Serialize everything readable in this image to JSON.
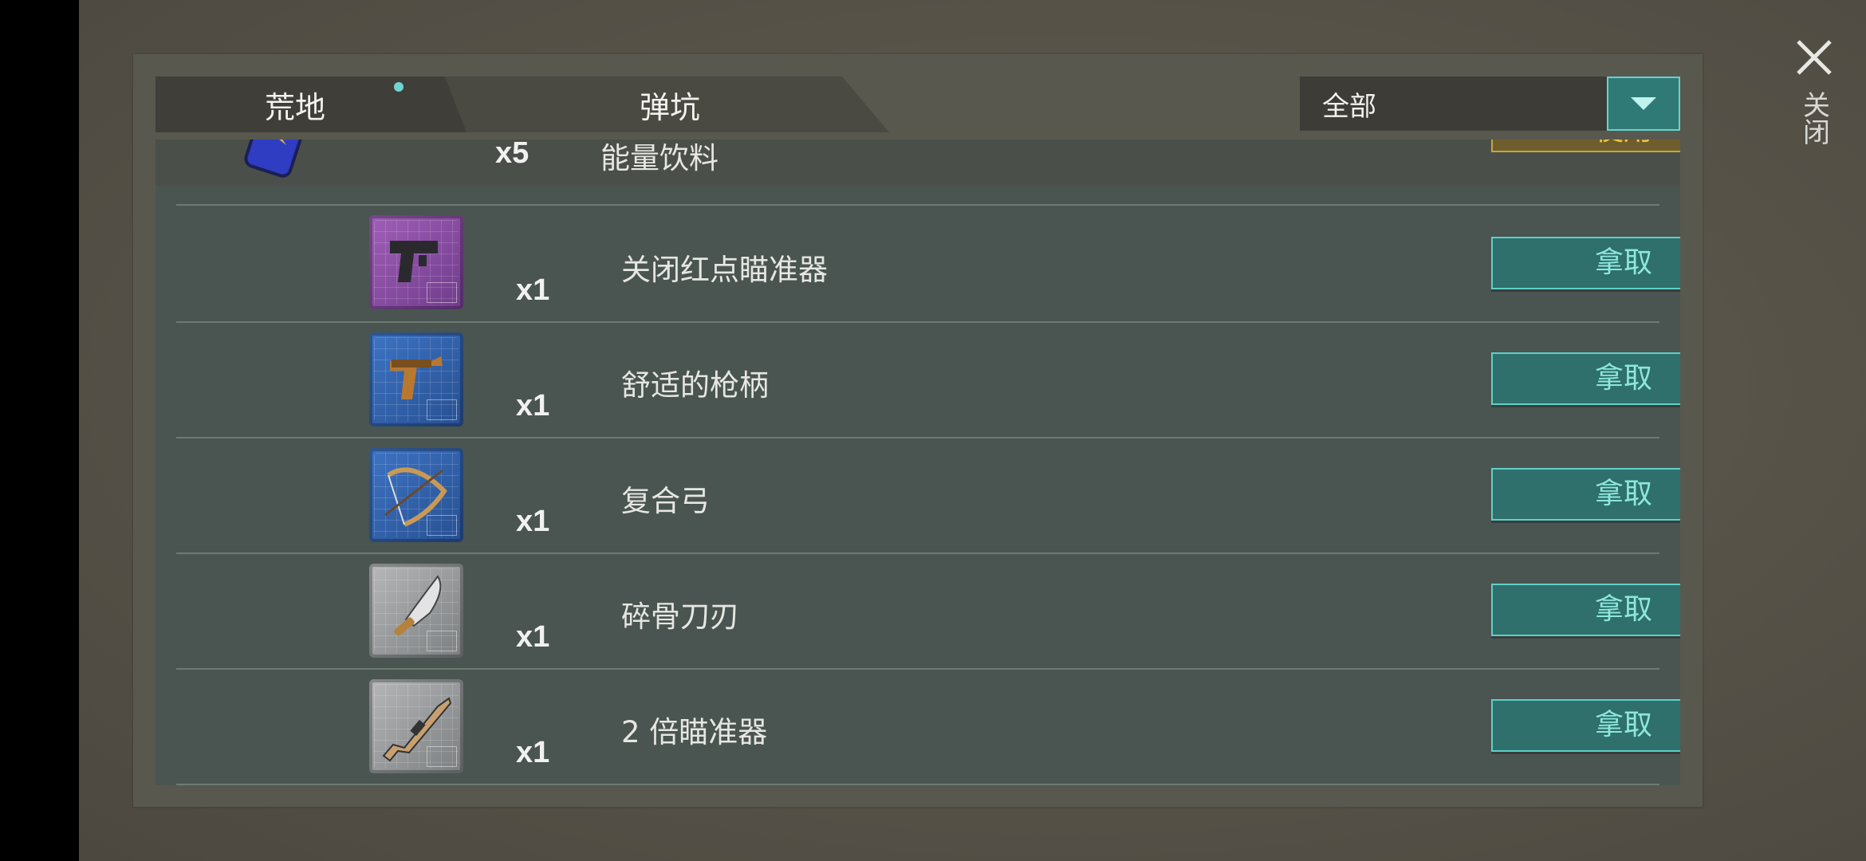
{
  "tabs": [
    {
      "label": "荒地",
      "active": true
    },
    {
      "label": "弹坑",
      "active": false
    }
  ],
  "filter": {
    "value": "全部"
  },
  "close": {
    "label": "关闭"
  },
  "partial_item": {
    "name": "能量饮料",
    "quantity": "x5",
    "button": "使用",
    "icon": "energy-drink-can"
  },
  "items": [
    {
      "name": "关闭红点瞄准器",
      "quantity": "x1",
      "button": "拿取",
      "icon": "pistol-blueprint",
      "color": "#9b59b6"
    },
    {
      "name": "舒适的枪柄",
      "quantity": "x1",
      "button": "拿取",
      "icon": "flare-gun-blueprint",
      "color": "#2f63b0"
    },
    {
      "name": "复合弓",
      "quantity": "x1",
      "button": "拿取",
      "icon": "compound-bow-blueprint",
      "color": "#2f63b0"
    },
    {
      "name": "碎骨刀刃",
      "quantity": "x1",
      "button": "拿取",
      "icon": "machete-blueprint",
      "color": "#a0a3a6"
    },
    {
      "name": "2 倍瞄准器",
      "quantity": "x1",
      "button": "拿取",
      "icon": "rifle-blueprint",
      "color": "#a0a3a6"
    }
  ]
}
